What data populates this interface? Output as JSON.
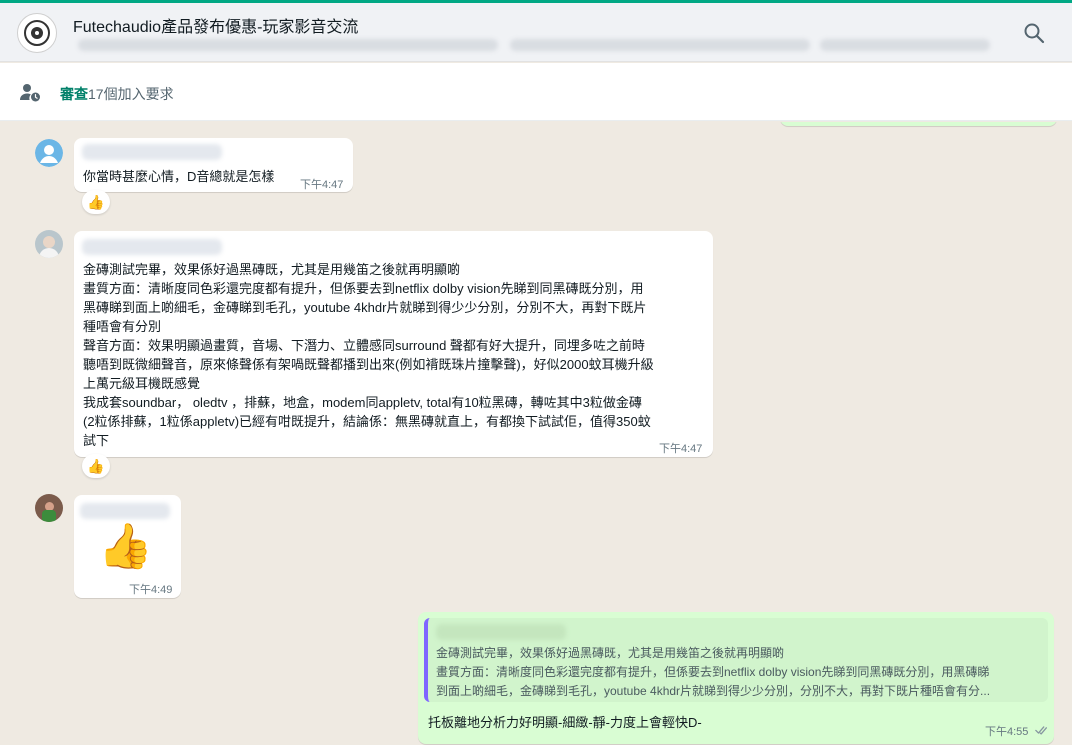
{
  "header": {
    "title": "Futechaudio產品發布優惠-玩家影音交流"
  },
  "pending": {
    "link_label": "審查",
    "text": "17個加入要求"
  },
  "messages": [
    {
      "text": "你當時甚麼心情，D音總就是怎樣",
      "time": "下午4:47",
      "reaction": "👍"
    },
    {
      "text": "金磚測試完畢，效果係好過黑磚既，尤其是用幾笛之後就再明顯啲\n畫質方面：清晰度同色彩還完度都有提升，但係要去到netflix dolby vision先睇到同黑磚既分別，用\n黑磚睇到面上啲細毛，金磚睇到毛孔，youtube 4khdr片就睇到得少少分別，分別不大，再對下既片\n種唔會有分別\n聲音方面：效果明顯過畫質，音場、下潛力、立體感同surround 聲都有好大提升，同埋多咗之前時\n聽唔到既微細聲音，原來條聲係有架喎既聲都播到出來(例如褙既珠片撞擊聲)，好似2000蚊耳機升級\n上萬元級耳機既感覺\n我成套soundbar， oledtv ，排蘇，地盒，modem同appletv, total有10粒黑磚，轉咗其中3粒做金磚\n(2粒係排蘇，1粒係appletv)已經有咁既提升，結論係：無黑磚就直上，有都換下試試佢，值得350蚊\n試下",
      "time": "下午4:47",
      "reaction": "👍"
    },
    {
      "sticker": "👍",
      "time": "下午4:49"
    },
    {
      "quote": "金磚測試完畢，效果係好過黑磚既，尤其是用幾笛之後就再明顯啲\n畫質方面：清晰度同色彩還完度都有提升，但係要去到netflix dolby vision先睇到同黑磚既分別，用黑磚睇\n到面上啲細毛，金磚睇到毛孔，youtube 4khdr片就睇到得少少分別，分別不大，再對下既片種唔會有分...",
      "text": "托板離地分析力好明顯-細緻-靜-力度上會輕快D-",
      "time": "下午4:55"
    }
  ],
  "colors": {
    "accent": "#00a884",
    "incoming_bubble": "#ffffff",
    "outgoing_bubble": "#d9fdd3",
    "quote_bar": "#7f66ff",
    "chat_bg": "#efeae2"
  },
  "icons": {
    "search": "search-icon",
    "pending": "person-clock-icon",
    "avatar_default": "default-avatar-icon",
    "ticks": "double-check-icon"
  }
}
